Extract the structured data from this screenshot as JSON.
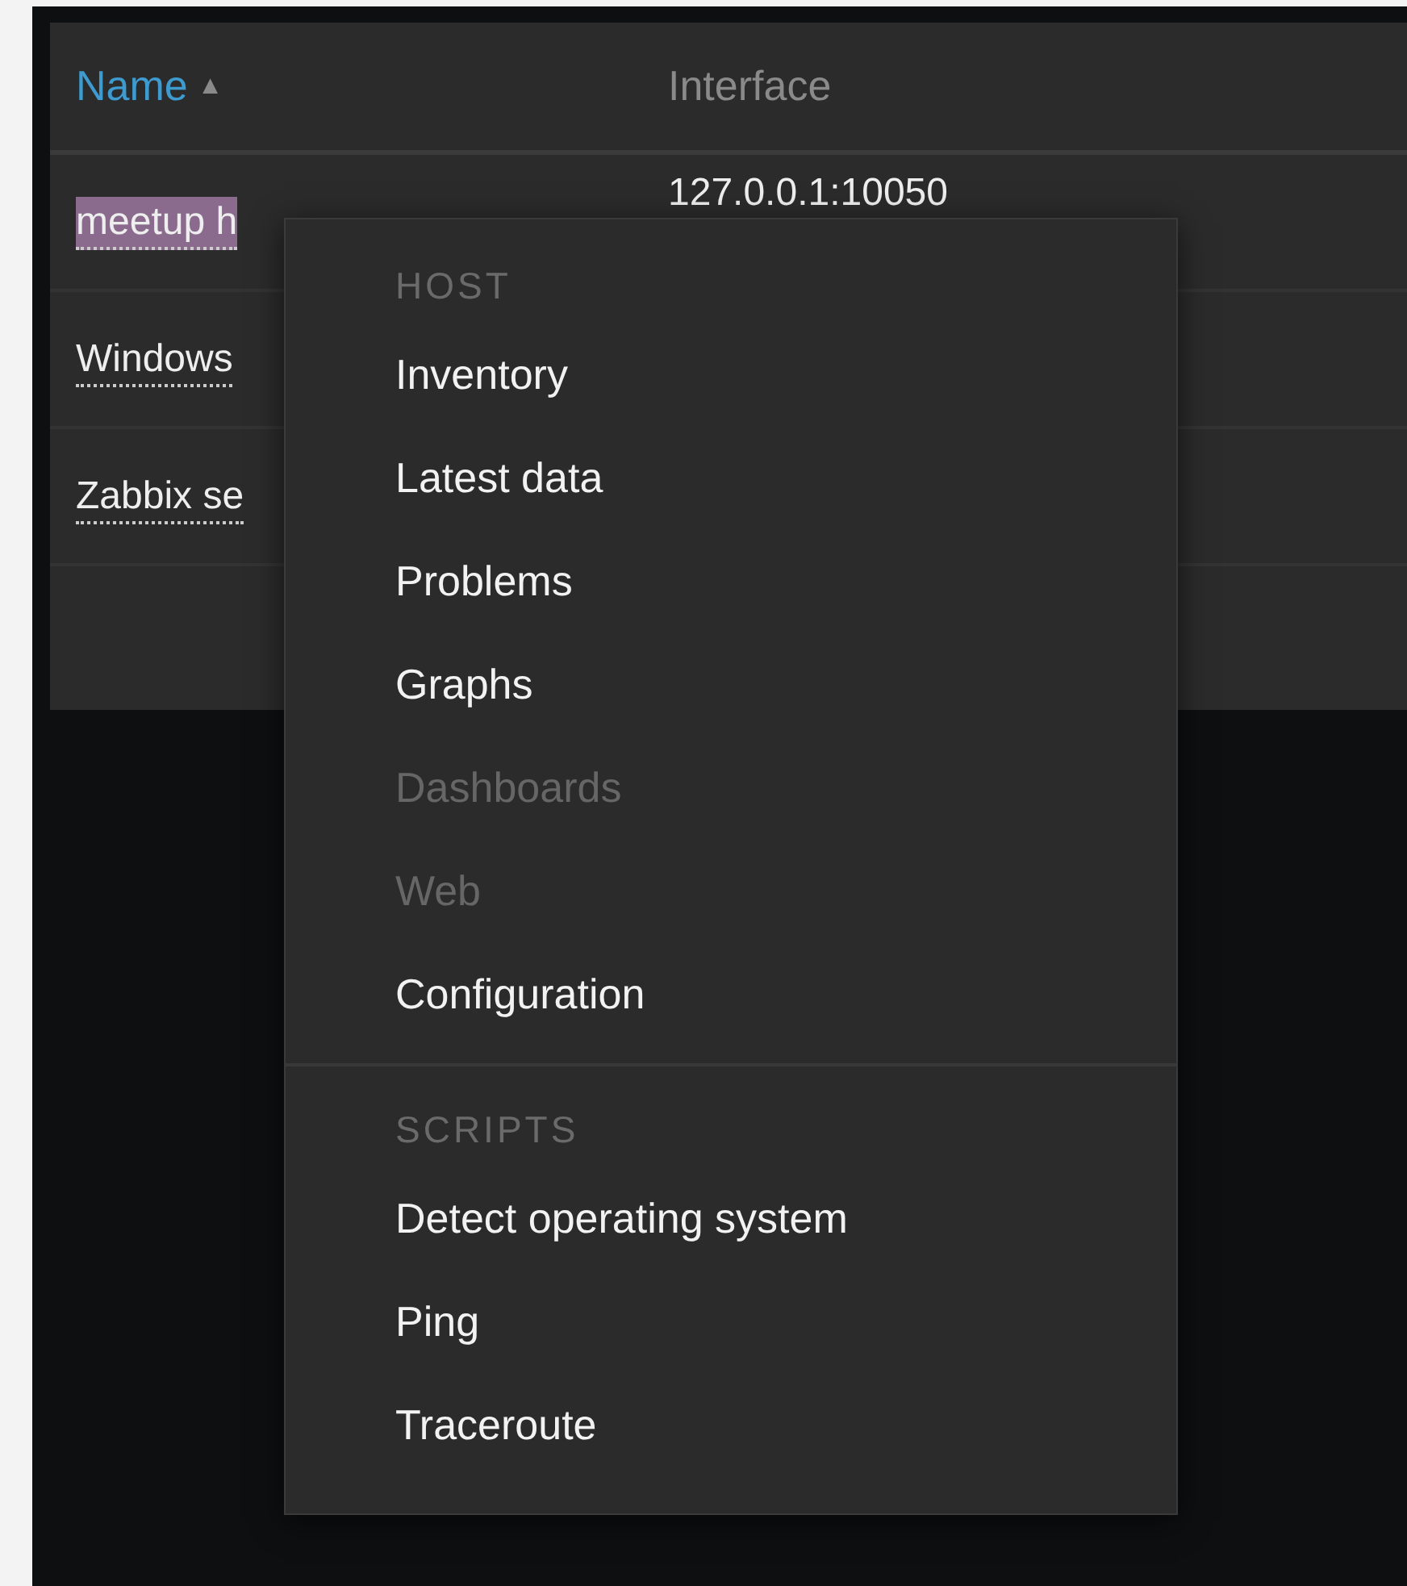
{
  "table": {
    "columns": [
      {
        "label": "Name",
        "sorted": true,
        "sort_icon": "▲"
      },
      {
        "label": "Interface",
        "sorted": false
      }
    ],
    "rows": [
      {
        "name": "meetup h",
        "selected": true,
        "interface": "127.0.0.1:10050"
      },
      {
        "name": "Windows",
        "selected": false
      },
      {
        "name": "Zabbix se",
        "selected": false
      }
    ]
  },
  "context_menu": {
    "sections": [
      {
        "header": "HOST",
        "items": [
          {
            "label": "Inventory",
            "disabled": false
          },
          {
            "label": "Latest data",
            "disabled": false
          },
          {
            "label": "Problems",
            "disabled": false
          },
          {
            "label": "Graphs",
            "disabled": false
          },
          {
            "label": "Dashboards",
            "disabled": true
          },
          {
            "label": "Web",
            "disabled": true
          },
          {
            "label": "Configuration",
            "disabled": false
          }
        ]
      },
      {
        "header": "SCRIPTS",
        "items": [
          {
            "label": "Detect operating system",
            "disabled": false
          },
          {
            "label": "Ping",
            "disabled": false
          },
          {
            "label": "Traceroute",
            "disabled": false
          }
        ]
      }
    ]
  }
}
